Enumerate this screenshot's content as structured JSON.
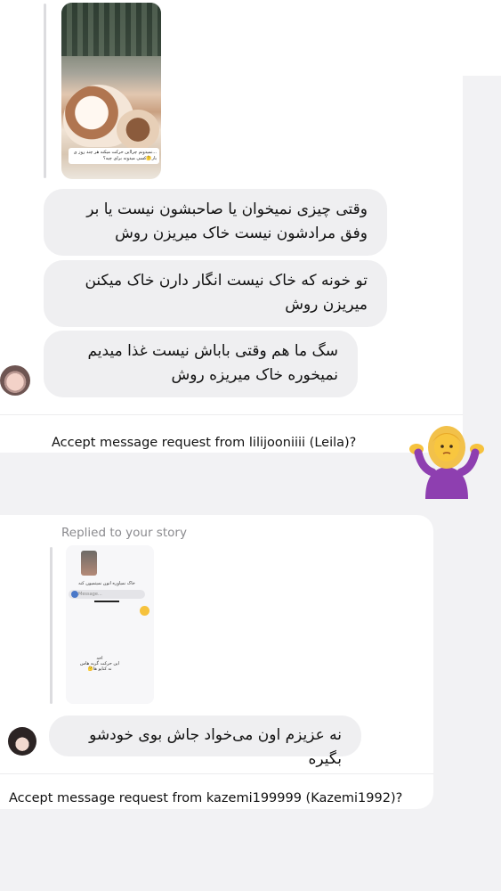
{
  "thread_1": {
    "story_caption": "...نمیدونم چرااین حرکت میکنه هر چند روز ی بار🤔کسی میدونه برای چیه؟",
    "messages": [
      "وقتی چیزی نمیخوان یا صاحبشون نیست یا بر وفق مرادشون نیست خاک میریزن روش",
      "تو خونه که خاک نیست انگار دارن خاک میکنن میریزن روش",
      "سگ ما هم وقتی باباش نیست غذا میدیم نمیخوره خاک میریزه روش"
    ],
    "request": "Accept message request from lilijooniiii (Leila)?"
  },
  "thread_2": {
    "replied_label": "Replied to your story",
    "story_lines": [
      "خاک نمیاوره انون نمیتمیون کنه",
      "Message...",
      "اخه",
      "این حرکت گربه هاس",
      "نه کنایو ها🤔"
    ],
    "message": "نه عزیزم اون می‌خواد جاش بوی خودشو بگیره",
    "request": "Accept message request from kazemi199999 (Kazemi1992)?"
  },
  "colors": {
    "bubble": "#efeff1",
    "background": "#f2f2f4",
    "secondary_text": "#8a8a8e",
    "emoji_shirt": "#8e3fb0",
    "emoji_hair": "#f2c14a"
  },
  "icons": {
    "shrug": "person-shrugging-emoji"
  }
}
